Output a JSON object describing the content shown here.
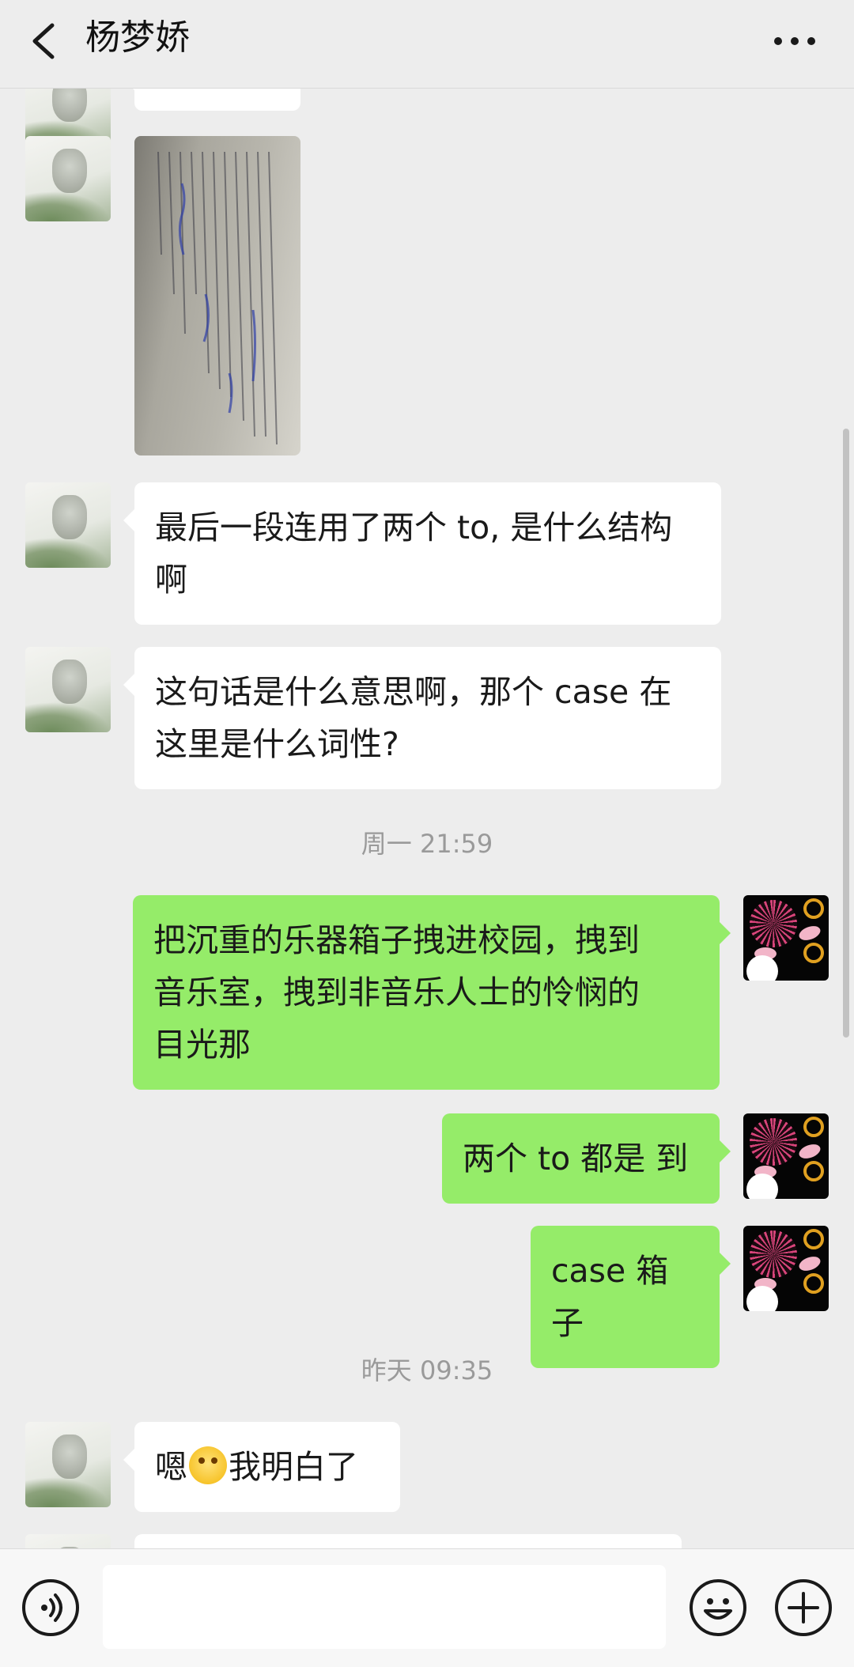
{
  "header": {
    "title": "杨梦娇"
  },
  "messages": [
    {
      "side": "in",
      "type": "image"
    },
    {
      "side": "in",
      "type": "text",
      "lines": [
        "最后一段连用了两个 to, 是什么结构",
        "啊"
      ]
    },
    {
      "side": "in",
      "type": "text",
      "lines": [
        "这句话是什么意思啊，那个 case 在",
        "这里是什么词性?"
      ]
    },
    {
      "type": "time",
      "text": "周一 21:59"
    },
    {
      "side": "out",
      "type": "text",
      "lines": [
        "把沉重的乐器箱子拽进校园，拽到",
        "音乐室，拽到非音乐人士的怜悯的",
        "目光那"
      ]
    },
    {
      "side": "out",
      "type": "text",
      "lines": [
        "两个 to 都是  到"
      ]
    },
    {
      "side": "out",
      "type": "text",
      "lines": [
        "case 箱子"
      ]
    },
    {
      "type": "time",
      "text": "昨天 09:35"
    },
    {
      "side": "in",
      "type": "text",
      "before_emoji": "嗯",
      "after_emoji": "我明白了",
      "emoji": "smile-emoji"
    }
  ],
  "input": {
    "value": "",
    "placeholder": ""
  },
  "icons": {
    "back": "chevron-left-icon",
    "more": "more-dots-icon",
    "voice": "voice-icon",
    "emoji": "emoji-icon",
    "add": "plus-icon"
  },
  "colors": {
    "background": "#ededed",
    "incoming_bubble": "#ffffff",
    "outgoing_bubble": "#95ec69",
    "timestamp": "#9a9a9a"
  }
}
